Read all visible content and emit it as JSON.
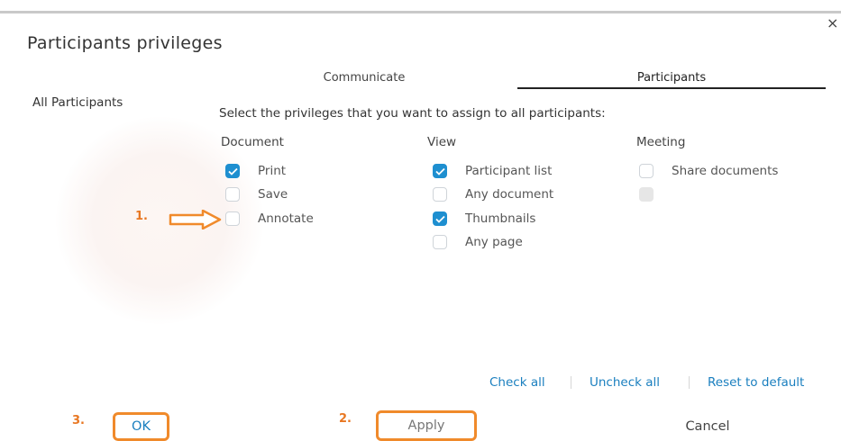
{
  "dialog": {
    "title": "Participants privileges",
    "close_symbol": "×"
  },
  "tabs": [
    {
      "label": "Communicate",
      "active": false
    },
    {
      "label": "Participants",
      "active": true
    }
  ],
  "sidebar": {
    "items": [
      {
        "label": "All Participants",
        "selected": true
      }
    ]
  },
  "main": {
    "instruction": "Select the privileges that you want to assign to all participants:",
    "columns": [
      {
        "heading": "Document",
        "options": [
          {
            "label": "Print",
            "checked": true
          },
          {
            "label": "Save",
            "checked": false
          },
          {
            "label": "Annotate",
            "checked": false
          }
        ]
      },
      {
        "heading": "View",
        "options": [
          {
            "label": "Participant list",
            "checked": true
          },
          {
            "label": "Any document",
            "checked": false
          },
          {
            "label": "Thumbnails",
            "checked": true
          },
          {
            "label": "Any page",
            "checked": false
          }
        ]
      },
      {
        "heading": "Meeting",
        "options": [
          {
            "label": "Share documents",
            "checked": false
          },
          {
            "label": "",
            "checked": false,
            "disabled": true
          }
        ]
      }
    ]
  },
  "links": {
    "check_all": "Check all",
    "uncheck_all": "Uncheck all",
    "reset_default": "Reset to default"
  },
  "buttons": {
    "ok": "OK",
    "apply": "Apply",
    "cancel": "Cancel"
  },
  "annotations": {
    "step1": "1.",
    "step2": "2.",
    "step3": "3.",
    "highlight_color": "#f08a2b",
    "arrow_icon": "right-arrow-icon"
  },
  "colors": {
    "accent": "#1e8fd0",
    "link": "#1a7fbf",
    "annotation": "#e87722"
  }
}
